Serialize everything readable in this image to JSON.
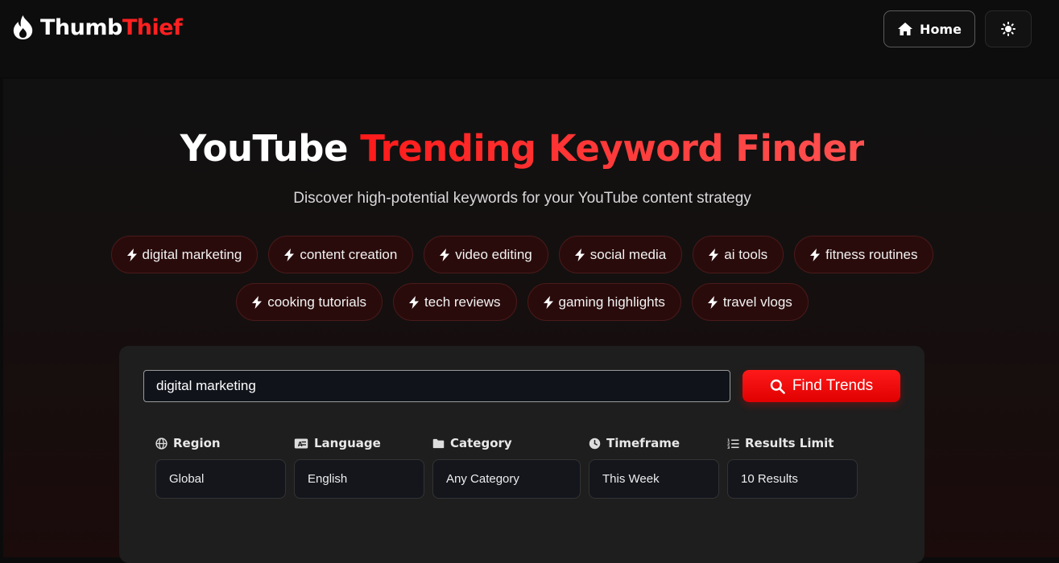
{
  "app": {
    "logo_part1": "Thumb",
    "logo_part2": "Thief",
    "accent_color": "#ff1a1a"
  },
  "nav": {
    "home_label": "Home",
    "home_icon": "home-icon",
    "theme_icon": "sun-icon"
  },
  "hero": {
    "title_part1": "YouTube",
    "title_part2": "Trending Keyword Finder",
    "subtitle": "Discover high-potential keywords for your YouTube content strategy"
  },
  "suggestions": {
    "row1": [
      "digital marketing",
      "content creation",
      "video editing",
      "social media",
      "ai tools",
      "fitness routines"
    ],
    "row2": [
      "cooking tutorials",
      "tech reviews",
      "gaming highlights",
      "travel vlogs"
    ],
    "icon": "bolt-icon"
  },
  "search": {
    "value": "digital marketing",
    "button_label": "Find Trends",
    "button_icon": "search-icon"
  },
  "filters": [
    {
      "label": "Region",
      "icon": "globe-icon",
      "value": "Global"
    },
    {
      "label": "Language",
      "icon": "language-card-icon",
      "value": "English"
    },
    {
      "label": "Category",
      "icon": "folder-icon",
      "value": "Any Category"
    },
    {
      "label": "Timeframe",
      "icon": "clock-icon",
      "value": "This Week"
    },
    {
      "label": "Results Limit",
      "icon": "list-ordered-icon",
      "value": "10 Results"
    }
  ]
}
